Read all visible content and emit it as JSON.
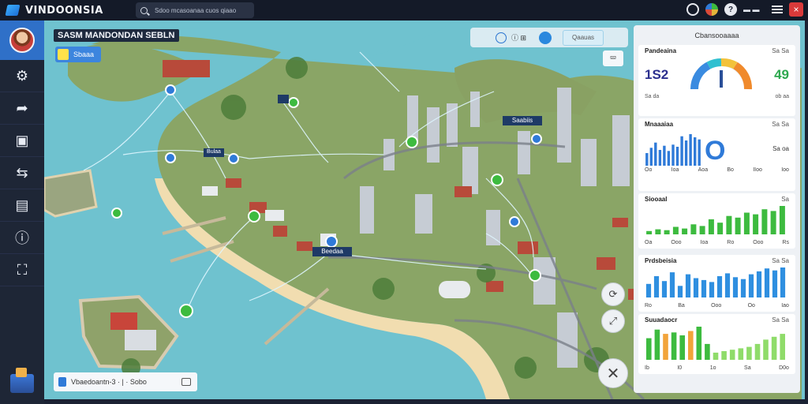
{
  "app": {
    "title": "VINDOONSIA"
  },
  "search": {
    "text": "Sdoo mcasoanaa cuos qiaao"
  },
  "topbar": {
    "help": "?",
    "user": "▬ ▬",
    "close": "×"
  },
  "sidebar": {
    "items": [
      {
        "icon": "gear-icon",
        "glyph": "⚙"
      },
      {
        "icon": "share-arrow-icon",
        "glyph": "➦"
      },
      {
        "icon": "monitor-icon",
        "glyph": "▣"
      },
      {
        "icon": "shuffle-icon",
        "glyph": "⇆"
      },
      {
        "icon": "calendar-icon",
        "glyph": "▤"
      },
      {
        "icon": "info-icon",
        "glyph": "ⓘ"
      },
      {
        "icon": "frame-icon",
        "glyph": "⛶"
      }
    ]
  },
  "map": {
    "title": "SASM MANDONDAN SEBLN",
    "chip": "Sbaaa",
    "toolbar": {
      "text": "ⓘ ⊞",
      "button": "Qaauas"
    },
    "export": "⮹",
    "labels": [
      "Saabiis",
      "Bulaa",
      "Bab",
      "Beedaa"
    ],
    "footer": {
      "text": "Vbaedoantn-3  ·  |  ·  Sobo"
    },
    "controls": {
      "refresh": "⟳",
      "expand": "⤢",
      "close": "✕"
    }
  },
  "panel": {
    "header": "Cbansooaaaa",
    "card1": {
      "title": "Pandeaina",
      "right": "Sa Sa",
      "left_value": "1S2",
      "right_value": "49",
      "sub_left": "Sa da",
      "sub_right": "ob aa"
    },
    "card2": {
      "title": "Mnaaaiaa",
      "right": "Sa Sa",
      "big": "O",
      "side": "Sa oa",
      "axis": [
        "Oo",
        "Ioa",
        "Aoa",
        "Bo",
        "IIoo",
        "Ioo"
      ]
    },
    "card3": {
      "title": "Siooaal",
      "right": "Sa",
      "axis": [
        "Oa",
        "Ooo",
        "Ioa",
        "Ro",
        "Ooo",
        "Rs"
      ]
    },
    "card4": {
      "title": "Prdsbeisia",
      "right": "Sa Sa",
      "axis": [
        "Ro",
        "Ba",
        "Ooo",
        "Oo",
        "Iao"
      ]
    },
    "card5": {
      "title": "Suuadaocr",
      "right": "Sa Sa",
      "axis": [
        "Ib",
        "I0",
        "1o",
        "Sa",
        "D0o"
      ]
    }
  },
  "colors": {
    "accent": "#2f7ad8",
    "green": "#3dbb3f",
    "water": "#6fc2cf",
    "land": "#8ea66a"
  },
  "chart_data": [
    {
      "type": "bar",
      "values": [
        12,
        17,
        22,
        15,
        19,
        14,
        20,
        18,
        28,
        24,
        30,
        27,
        25
      ]
    },
    {
      "type": "bar",
      "values": [
        4,
        6,
        5,
        9,
        7,
        12,
        10,
        18,
        14,
        22,
        20,
        26,
        24,
        30,
        28,
        34
      ]
    },
    {
      "type": "bar",
      "values": [
        14,
        22,
        17,
        26,
        12,
        24,
        20,
        18,
        16,
        22,
        25,
        21,
        19,
        24,
        27,
        30,
        28,
        31
      ]
    },
    {
      "type": "bar",
      "values": [
        30,
        42,
        36,
        38,
        34,
        40,
        46,
        22,
        10,
        12,
        14,
        16,
        18,
        22,
        28,
        32,
        36
      ]
    }
  ]
}
